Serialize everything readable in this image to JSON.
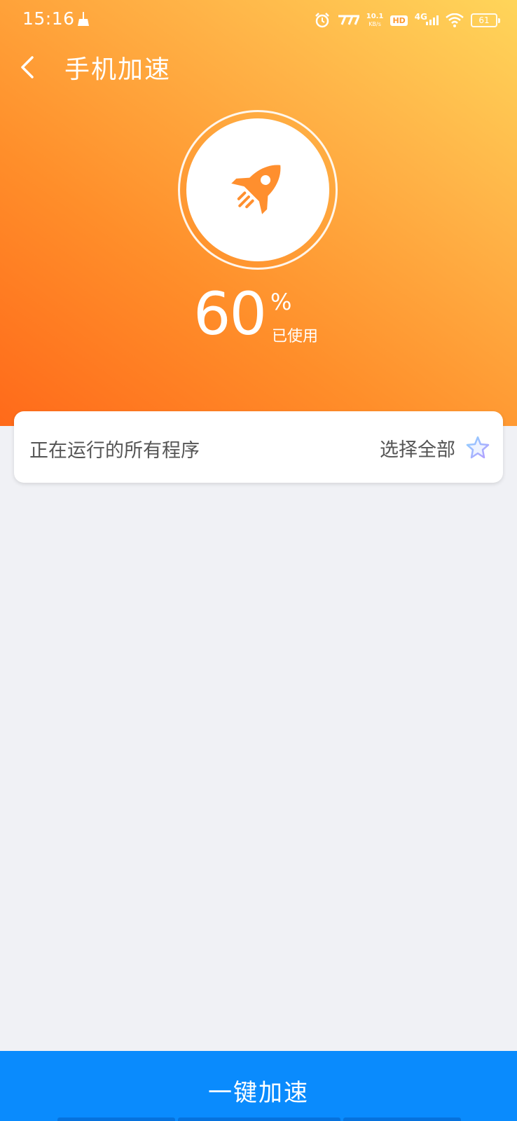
{
  "status_bar": {
    "time": "15:16",
    "net_speed_value": "10.1",
    "net_speed_unit": "KB/s",
    "hd_label": "HD",
    "network_label": "4G",
    "battery_level": "61"
  },
  "header": {
    "title": "手机加速"
  },
  "gauge": {
    "value": "60",
    "unit": "%",
    "label": "已使用"
  },
  "programs_card": {
    "title": "正在运行的所有程序",
    "select_all_label": "选择全部"
  },
  "action": {
    "boost_label": "一键加速"
  },
  "colors": {
    "hero_gradient_start": "#ff6a1a",
    "hero_gradient_end": "#ffd55a",
    "accent_orange": "#ff8f2e",
    "button_blue": "#0a8bfd",
    "page_background": "#f0f1f5"
  }
}
